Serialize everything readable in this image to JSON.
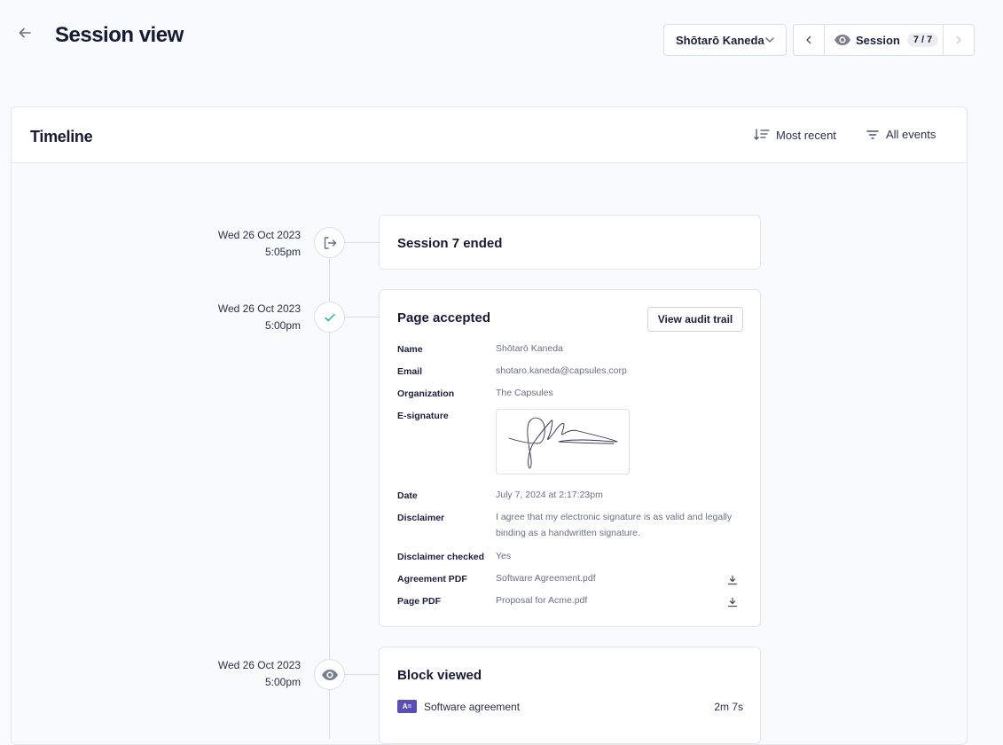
{
  "header": {
    "title": "Session view",
    "user": "Shōtarō Kaneda",
    "session_label": "Session",
    "session_count": "7 / 7"
  },
  "timeline": {
    "title": "Timeline",
    "sort_label": "Most recent",
    "filter_label": "All events"
  },
  "events": [
    {
      "date": "Wed 26 Oct 2023",
      "time": "5:05pm",
      "icon": "logout-icon",
      "title": "Session 7 ended"
    },
    {
      "date": "Wed 26 Oct 2023",
      "time": "5:00pm",
      "icon": "check-icon",
      "title": "Page accepted",
      "action_label": "View audit trail",
      "fields": {
        "name_label": "Name",
        "name": "Shōtarō Kaneda",
        "email_label": "Email",
        "email": "shotaro.kaneda@capsules.corp",
        "org_label": "Organization",
        "org": "The Capsules",
        "esig_label": "E-signature",
        "date_label": "Date",
        "date": "July 7, 2024 at 2:17:23pm",
        "disclaimer_label": "Disclaimer",
        "disclaimer": "I agree that my electronic signature is as valid and legally binding as a handwritten signature.",
        "checked_label": "Disclaimer checked",
        "checked": "Yes",
        "agreement_label": "Agreement PDF",
        "agreement": "Software Agreement.pdf",
        "page_pdf_label": "Page PDF",
        "page_pdf": "Proposal for Acme.pdf"
      }
    },
    {
      "date": "Wed 26 Oct 2023",
      "time": "5:00pm",
      "icon": "eye-icon",
      "title": "Block viewed",
      "block_tag": "A=",
      "block_name": "Software agreement",
      "duration": "2m 7s"
    }
  ],
  "colors": {
    "accent_check": "#2bb5a0",
    "block_tag": "#5a4fb8"
  }
}
